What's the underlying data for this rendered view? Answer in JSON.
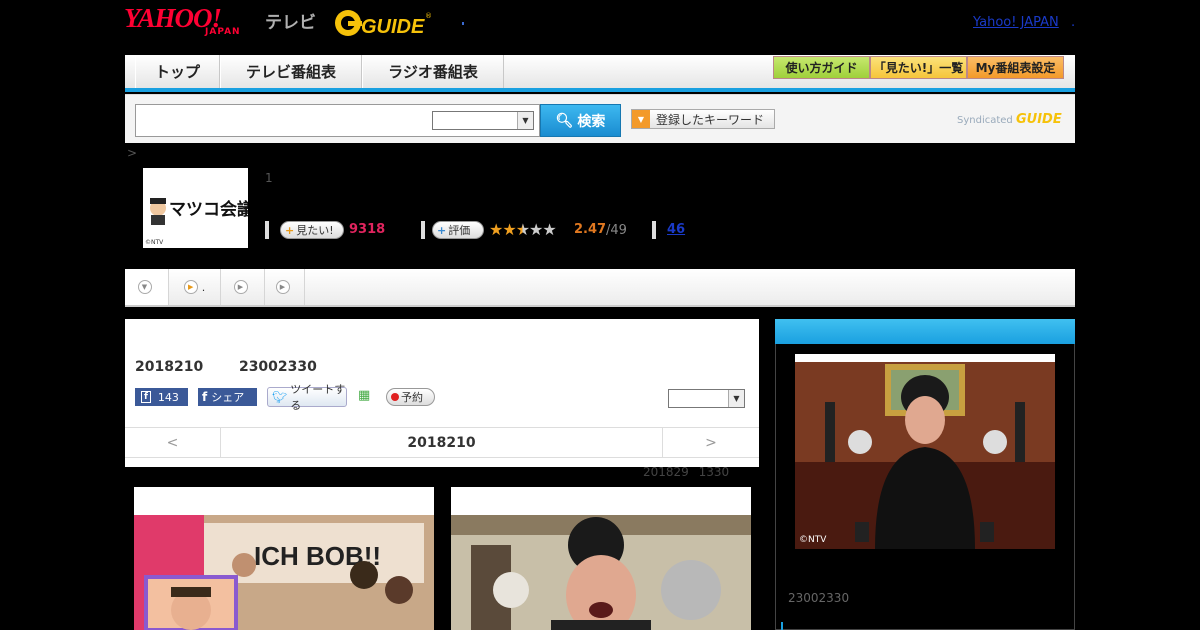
{
  "header": {
    "yahoo_logo": "YAHOO!",
    "yahoo_japan": "JAPAN",
    "tv_label": "テレビ",
    "gguide_logo": "GUIDE",
    "yahoo_japan_link": "Yahoo! JAPAN",
    "link_dot": "."
  },
  "nav": {
    "tabs": [
      {
        "label": "トップ"
      },
      {
        "label": "テレビ番組表"
      },
      {
        "label": "ラジオ番組表"
      }
    ],
    "guide_buttons": [
      {
        "label": "使い方ガイド",
        "color": "#9fd03a"
      },
      {
        "label": "「見たい!」一覧",
        "color": "#f6c53a"
      },
      {
        "label": "My番組表設定",
        "color": "#f39a2a"
      }
    ],
    "accent": "#1aa0e0"
  },
  "search": {
    "input_value": "",
    "select_value": "",
    "button_label": "検索",
    "keyword_button_label": "登録したキーワード",
    "syndicated_label": "Syndicated",
    "syndicated_logo": "GUIDE"
  },
  "program": {
    "breadcrumb": ">",
    "thumb_text": "マツコ会議",
    "thumb_copyright": "©NTV",
    "episode_number": "1",
    "wanted_label": "見たい!",
    "wanted_count": "9318",
    "rate_label": "評価",
    "rating_value": "2.47",
    "rating_sub": "/49",
    "stars": 2.47,
    "star_max": 5,
    "comments": "46"
  },
  "tabs": [
    {
      "label": ""
    },
    {
      "label": "."
    },
    {
      "label": ""
    },
    {
      "label": ""
    }
  ],
  "main": {
    "date": "2018210",
    "time": "23002330",
    "fb_like_count": "143",
    "fb_share_label": "シェア",
    "tweet_label": "ツイートする",
    "reserve_label": "予約",
    "select_value": "",
    "prev_arrow": "<",
    "next_arrow": ">",
    "nav_date": "2018210",
    "updated_date": "201829",
    "updated_time": "1330"
  },
  "right": {
    "copyright": "©NTV",
    "time": "23002330"
  }
}
